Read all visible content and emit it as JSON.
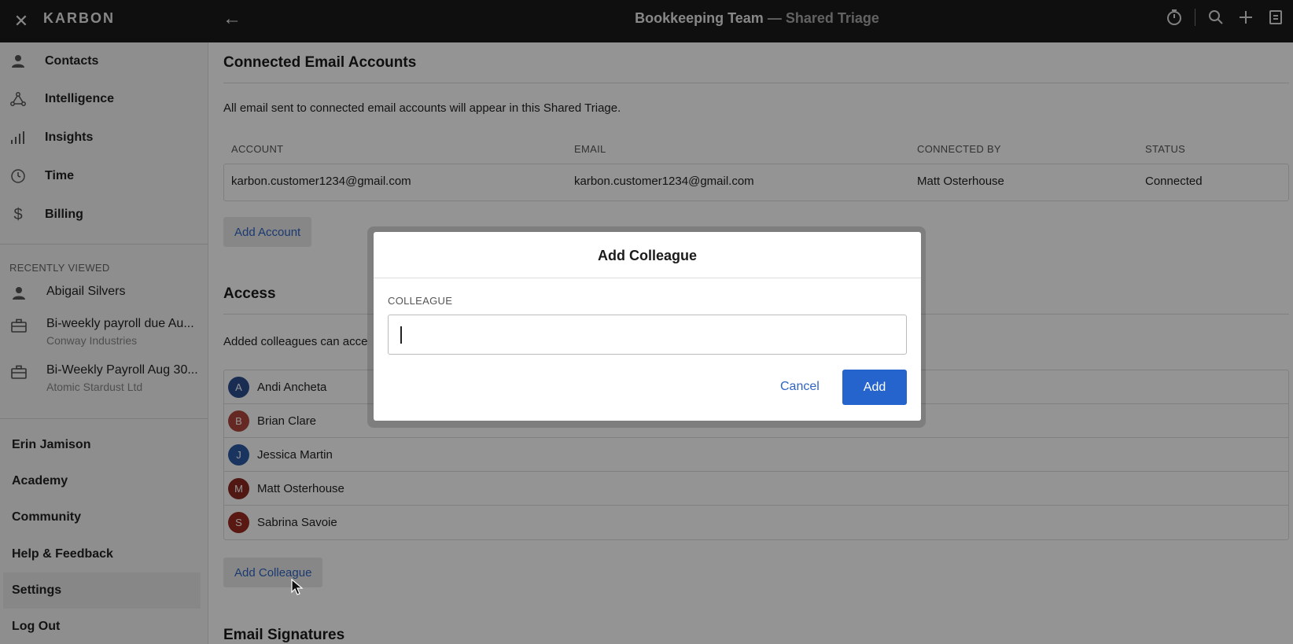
{
  "app": {
    "brand": "KARBON"
  },
  "topbar": {
    "title_main": "Bookkeeping Team",
    "title_sep": " — ",
    "title_sub": "Shared Triage",
    "icons": [
      "timer-icon",
      "search-icon",
      "plus-icon",
      "notes-icon"
    ]
  },
  "sidebar": {
    "nav": [
      {
        "label": "Contacts",
        "icon": "person-icon"
      },
      {
        "label": "Intelligence",
        "icon": "network-icon"
      },
      {
        "label": "Insights",
        "icon": "bar-chart-icon"
      },
      {
        "label": "Time",
        "icon": "clock-icon"
      },
      {
        "label": "Billing",
        "icon": "dollar-icon"
      }
    ],
    "recently_viewed_heading": "RECENTLY VIEWED",
    "recent": [
      {
        "title": "Abigail Silvers",
        "subtitle": "",
        "icon": "person-icon"
      },
      {
        "title": "Bi-weekly payroll due Au...",
        "subtitle": "Conway Industries",
        "icon": "briefcase-icon"
      },
      {
        "title": "Bi-Weekly Payroll Aug 30...",
        "subtitle": "Atomic Stardust Ltd",
        "icon": "briefcase-icon"
      }
    ],
    "bottom": [
      "Erin Jamison",
      "Academy",
      "Community",
      "Help & Feedback",
      "Settings",
      "Log Out"
    ],
    "active_bottom": "Settings"
  },
  "main": {
    "connected": {
      "heading": "Connected Email Accounts",
      "description": "All email sent to connected email accounts will appear in this Shared Triage.",
      "columns": [
        "ACCOUNT",
        "EMAIL",
        "CONNECTED BY",
        "STATUS"
      ],
      "rows": [
        {
          "account": "karbon.customer1234@gmail.com",
          "email": "karbon.customer1234@gmail.com",
          "connected_by": "Matt Osterhouse",
          "status": "Connected"
        }
      ],
      "add_button": "Add Account"
    },
    "access": {
      "heading": "Access",
      "description": "Added colleagues can acce",
      "colleagues": [
        {
          "initial": "A",
          "name": "Andi Ancheta",
          "color": "#2c4f8f"
        },
        {
          "initial": "B",
          "name": "Brian Clare",
          "color": "#b0453b"
        },
        {
          "initial": "J",
          "name": "Jessica Martin",
          "color": "#2d5aa6"
        },
        {
          "initial": "M",
          "name": "Matt Osterhouse",
          "color": "#8c2a22"
        },
        {
          "initial": "S",
          "name": "Sabrina Savoie",
          "color": "#9a2a1e"
        }
      ],
      "add_button": "Add Colleague"
    },
    "signatures": {
      "heading": "Email Signatures"
    }
  },
  "modal": {
    "title": "Add Colleague",
    "field_label": "COLLEAGUE",
    "field_value": "",
    "field_placeholder": "",
    "cancel": "Cancel",
    "add": "Add"
  },
  "colors": {
    "accent": "#2464cc",
    "link": "#2f64c2",
    "topbar": "#1b1b1b"
  }
}
